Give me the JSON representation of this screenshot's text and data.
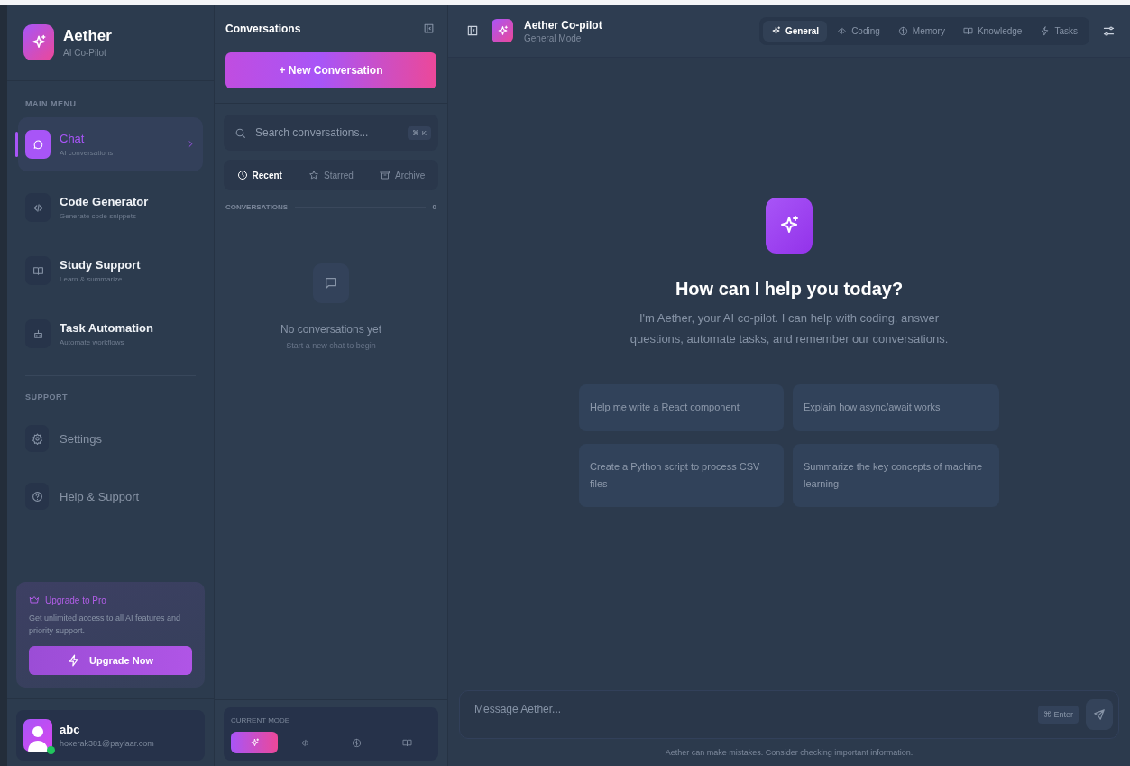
{
  "brand": {
    "name": "Aether",
    "tagline": "AI Co-Pilot"
  },
  "main_menu": {
    "heading": "MAIN MENU",
    "items": [
      {
        "label": "Chat",
        "subtitle": "AI conversations",
        "selected": true
      },
      {
        "label": "Code Generator",
        "subtitle": "Generate code snippets",
        "selected": false
      },
      {
        "label": "Study Support",
        "subtitle": "Learn & summarize",
        "selected": false
      },
      {
        "label": "Task Automation",
        "subtitle": "Automate workflows",
        "selected": false
      }
    ]
  },
  "support": {
    "heading": "SUPPORT",
    "items": [
      {
        "label": "Settings"
      },
      {
        "label": "Help & Support"
      }
    ]
  },
  "upgrade": {
    "title": "Upgrade to Pro",
    "text": "Get unlimited access to all AI features and priority support.",
    "button": "Upgrade Now"
  },
  "user": {
    "name": "abc",
    "email": "hoxerak381@paylaar.com",
    "online": true
  },
  "conversations": {
    "title": "Conversations",
    "new_button": "+ New Conversation",
    "search": {
      "placeholder": "Search conversations...",
      "shortcut": "⌘ K"
    },
    "filters": [
      {
        "label": "Recent",
        "selected": true
      },
      {
        "label": "Starred",
        "selected": false
      },
      {
        "label": "Archive",
        "selected": false
      }
    ],
    "section_label": "CONVERSATIONS",
    "count": "0",
    "empty_title": "No conversations yet",
    "empty_hint": "Start a new chat to begin",
    "current_mode": {
      "label": "CURRENT MODE",
      "modes": [
        {
          "selected": true
        },
        {
          "selected": false
        },
        {
          "selected": false
        },
        {
          "selected": false
        }
      ]
    }
  },
  "header": {
    "title": "Aether Co-pilot",
    "subtitle": "General Mode",
    "tabs": [
      {
        "label": "General",
        "selected": true
      },
      {
        "label": "Coding",
        "selected": false
      },
      {
        "label": "Memory",
        "selected": false
      },
      {
        "label": "Knowledge",
        "selected": false
      },
      {
        "label": "Tasks",
        "selected": false
      }
    ]
  },
  "welcome": {
    "title": "How can I help you today?",
    "text": "I'm Aether, your AI co-pilot. I can help with coding, answer questions, automate tasks, and remember our conversations.",
    "suggestions": [
      "Help me write a React component",
      "Explain how async/await works",
      "Create a Python script to process CSV files",
      "Summarize the key concepts of machine learning"
    ]
  },
  "composer": {
    "placeholder": "Message Aether...",
    "shortcut": "⌘ Enter",
    "disclaimer": "Aether can make mistakes. Consider checking important information."
  }
}
